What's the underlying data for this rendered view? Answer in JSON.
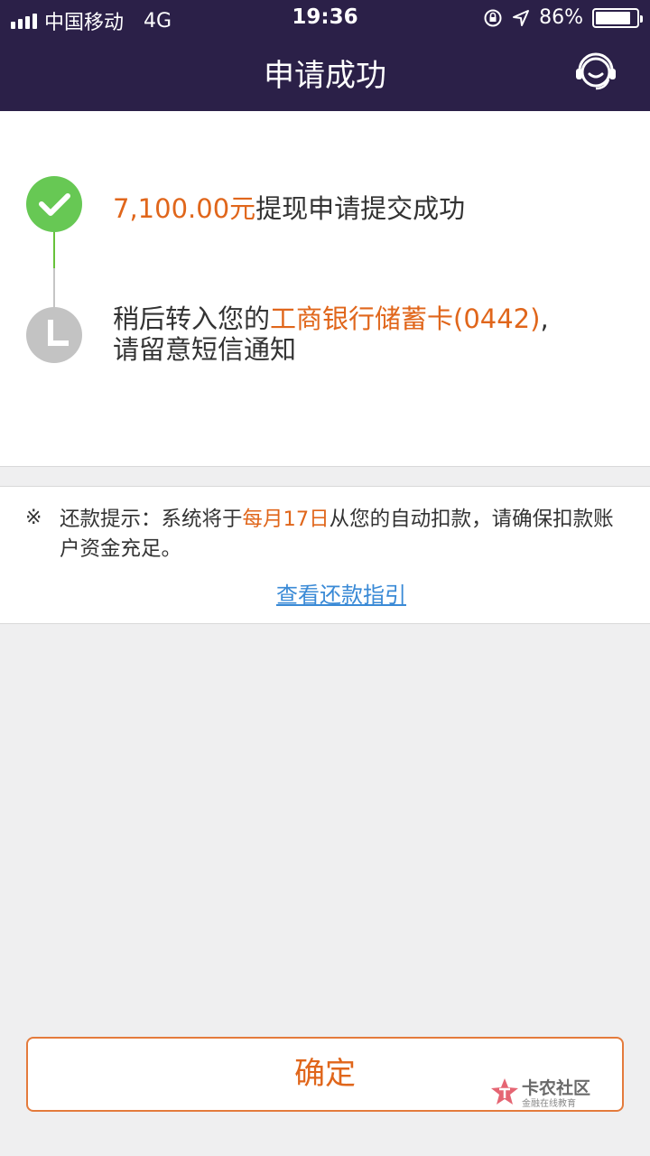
{
  "status_bar": {
    "carrier": "中国移动",
    "network": "4G",
    "time": "19:36",
    "battery": "86%",
    "battery_level": 0.86
  },
  "nav": {
    "title": "申请成功",
    "service_icon": "customer-service-headset-icon"
  },
  "steps": [
    {
      "icon": "check-icon",
      "amount": "7,100.00元",
      "text": "提现申请提交成功",
      "color": "#67c854"
    },
    {
      "icon": "clock-icon",
      "prefix": "稍后转入您的",
      "bank": "工商银行储蓄卡(0442)",
      "suffix": ",",
      "line2": "请留意短信通知",
      "color": "#c3c3c3"
    }
  ],
  "tip": {
    "mark": "※",
    "prefix": "还款提示：系统将于",
    "date": "每月17日",
    "suffix": "从您的自动扣款，请确保扣款账户资金充足。",
    "link": "查看还款指引"
  },
  "confirm_button": "确定",
  "watermark": {
    "name": "卡农社区",
    "subtitle": "金融在线教育"
  },
  "colors": {
    "header_bg": "#2b2048",
    "accent_orange": "#e0661b",
    "link_blue": "#3a8ad6",
    "success_green": "#67c854"
  }
}
